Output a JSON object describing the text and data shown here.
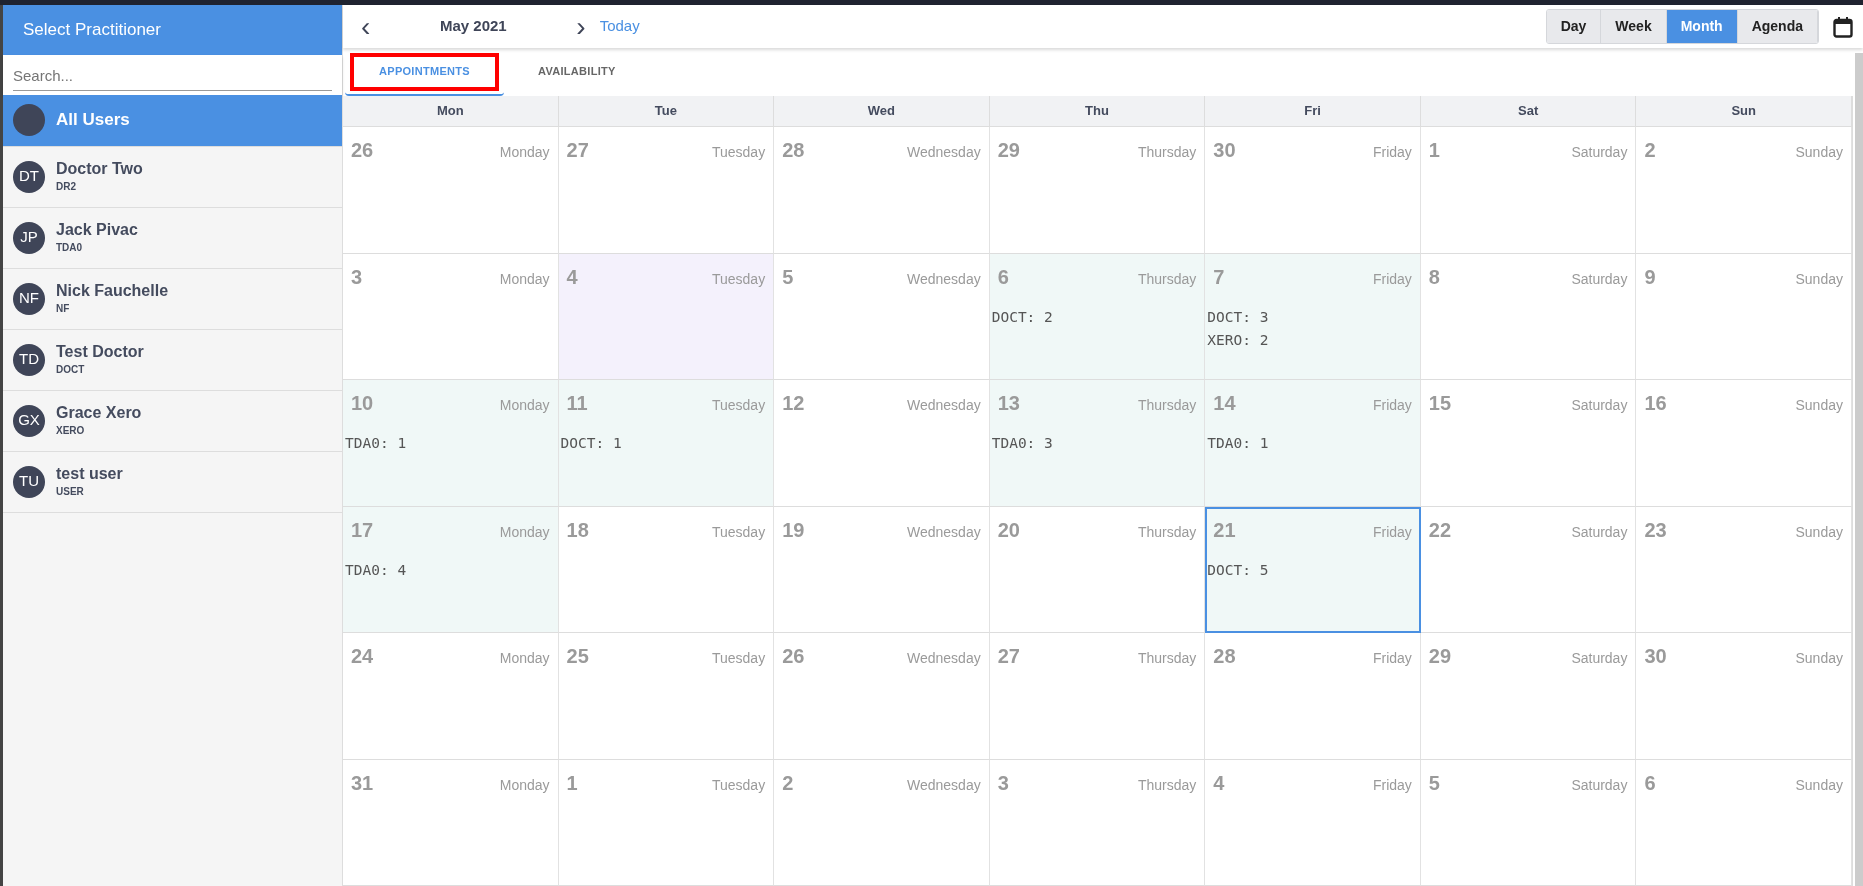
{
  "sidebar": {
    "title": "Select Practitioner",
    "search": {
      "placeholder": "Search..."
    },
    "users": [
      {
        "name": "All Users",
        "selected": true
      },
      {
        "initials": "DT",
        "name": "Doctor Two",
        "code": "DR2",
        "selected": false
      },
      {
        "initials": "JP",
        "name": "Jack Pivac",
        "code": "TDA0",
        "selected": false
      },
      {
        "initials": "NF",
        "name": "Nick Fauchelle",
        "code": "NF",
        "selected": false
      },
      {
        "initials": "TD",
        "name": "Test Doctor",
        "code": "DOCT",
        "selected": false
      },
      {
        "initials": "GX",
        "name": "Grace Xero",
        "code": "XERO",
        "selected": false
      },
      {
        "initials": "TU",
        "name": "test user",
        "code": "USER",
        "selected": false
      }
    ]
  },
  "toolbar": {
    "prev": "‹",
    "month": "May 2021",
    "next": "›",
    "today": "Today",
    "views": [
      {
        "label": "Day",
        "selected": false
      },
      {
        "label": "Week",
        "selected": false
      },
      {
        "label": "Month",
        "selected": true
      },
      {
        "label": "Agenda",
        "selected": false
      }
    ]
  },
  "tabs": [
    {
      "label": "APPOINTMENTS",
      "selected": true,
      "outlined": true
    },
    {
      "label": "AVAILABILITY",
      "selected": false,
      "outlined": false
    }
  ],
  "weekdays": [
    "Mon",
    "Tue",
    "Wed",
    "Thu",
    "Fri",
    "Sat",
    "Sun"
  ],
  "weeks": [
    [
      {
        "date": "26",
        "weekday": "Monday"
      },
      {
        "date": "27",
        "weekday": "Tuesday"
      },
      {
        "date": "28",
        "weekday": "Wednesday"
      },
      {
        "date": "29",
        "weekday": "Thursday"
      },
      {
        "date": "30",
        "weekday": "Friday"
      },
      {
        "date": "1",
        "weekday": "Saturday"
      },
      {
        "date": "2",
        "weekday": "Sunday"
      }
    ],
    [
      {
        "date": "3",
        "weekday": "Monday"
      },
      {
        "date": "4",
        "weekday": "Tuesday",
        "today": true
      },
      {
        "date": "5",
        "weekday": "Wednesday"
      },
      {
        "date": "6",
        "weekday": "Thursday",
        "entries": [
          "DOCT: 2"
        ]
      },
      {
        "date": "7",
        "weekday": "Friday",
        "entries": [
          "DOCT: 3",
          "XERO: 2"
        ]
      },
      {
        "date": "8",
        "weekday": "Saturday"
      },
      {
        "date": "9",
        "weekday": "Sunday"
      }
    ],
    [
      {
        "date": "10",
        "weekday": "Monday",
        "entries": [
          "TDA0: 1"
        ]
      },
      {
        "date": "11",
        "weekday": "Tuesday",
        "entries": [
          "DOCT: 1"
        ]
      },
      {
        "date": "12",
        "weekday": "Wednesday"
      },
      {
        "date": "13",
        "weekday": "Thursday",
        "entries": [
          "TDA0: 3"
        ]
      },
      {
        "date": "14",
        "weekday": "Friday",
        "entries": [
          "TDA0: 1"
        ]
      },
      {
        "date": "15",
        "weekday": "Saturday"
      },
      {
        "date": "16",
        "weekday": "Sunday"
      }
    ],
    [
      {
        "date": "17",
        "weekday": "Monday",
        "entries": [
          "TDA0: 4"
        ]
      },
      {
        "date": "18",
        "weekday": "Tuesday"
      },
      {
        "date": "19",
        "weekday": "Wednesday"
      },
      {
        "date": "20",
        "weekday": "Thursday"
      },
      {
        "date": "21",
        "weekday": "Friday",
        "selected": true,
        "entries": [
          "DOCT: 5"
        ]
      },
      {
        "date": "22",
        "weekday": "Saturday"
      },
      {
        "date": "23",
        "weekday": "Sunday"
      }
    ],
    [
      {
        "date": "24",
        "weekday": "Monday"
      },
      {
        "date": "25",
        "weekday": "Tuesday"
      },
      {
        "date": "26",
        "weekday": "Wednesday"
      },
      {
        "date": "27",
        "weekday": "Thursday"
      },
      {
        "date": "28",
        "weekday": "Friday"
      },
      {
        "date": "29",
        "weekday": "Saturday"
      },
      {
        "date": "30",
        "weekday": "Sunday"
      }
    ],
    [
      {
        "date": "31",
        "weekday": "Monday"
      },
      {
        "date": "1",
        "weekday": "Tuesday"
      },
      {
        "date": "2",
        "weekday": "Wednesday"
      },
      {
        "date": "3",
        "weekday": "Thursday"
      },
      {
        "date": "4",
        "weekday": "Friday"
      },
      {
        "date": "5",
        "weekday": "Saturday"
      },
      {
        "date": "6",
        "weekday": "Sunday"
      }
    ]
  ]
}
